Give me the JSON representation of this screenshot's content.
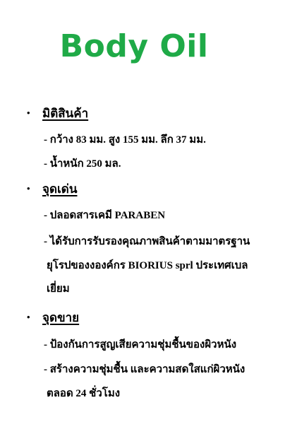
{
  "title": "Body Oil",
  "title_color": "#1faa47",
  "sections": [
    {
      "bullet": "•",
      "heading": "มิติสินค้า",
      "lines": [
        "- กว้าง 83 มม. สูง 155 มม.  ลึก 37 มม.",
        "- น้ำหนัก 250 มล."
      ]
    },
    {
      "bullet": "•",
      "heading": "จุดเด่น",
      "lines": [
        "- ปลอดสารเคมี PARABEN",
        "- ได้รับการรับรองคุณภาพสินค้าตามมาตรฐาน",
        "ยุโรปของงองค์กร  BIORIUS  sprl ประเทศเบล",
        "เยี่ยม"
      ]
    },
    {
      "bullet": "•",
      "heading": "จุดขาย",
      "lines": [
        "- ป้องกันการสูญเสียความชุ่มชื้นของผิวหนัง",
        "- สร้างความชุ่มชื้น และความสดใสแก่ผิวหนัง",
        "ตลอด 24 ชั่วโมง"
      ]
    }
  ]
}
